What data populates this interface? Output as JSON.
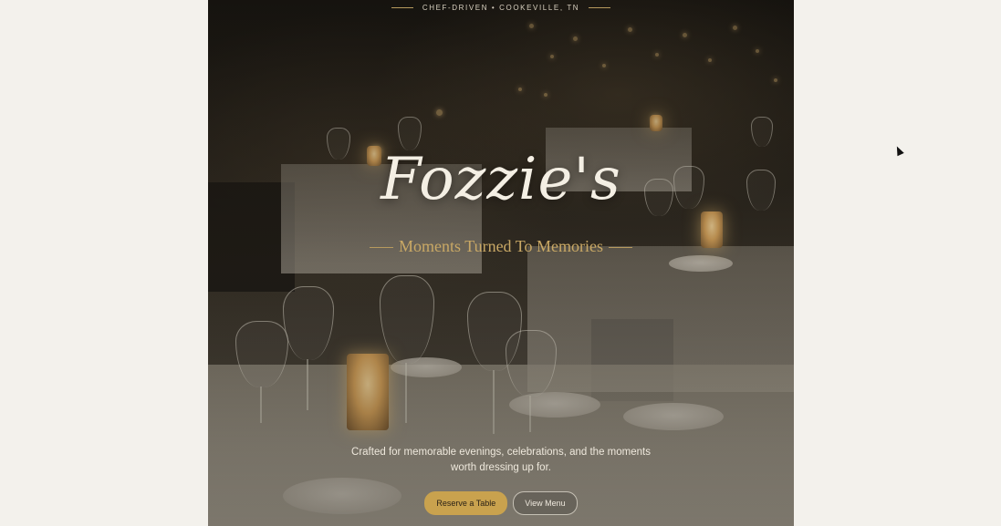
{
  "hero": {
    "eyebrow": "CHEF-DRIVEN • COOKEVILLE, TN",
    "brand": "Fozzie's",
    "tagline": "Moments Turned To Memories",
    "blurb_line1": "Crafted for memorable evenings, celebrations, and the moments",
    "blurb_line2": "worth dressing up for.",
    "primary_cta": "Reserve a Table",
    "secondary_cta": "View Menu"
  },
  "colors": {
    "page_background": "#f3f1ec",
    "accent_gold": "#c9a24e",
    "tagline_gold": "#c9a865",
    "headline": "#f4efe4"
  },
  "icons": {
    "pointer": "mouse-cursor-icon"
  }
}
